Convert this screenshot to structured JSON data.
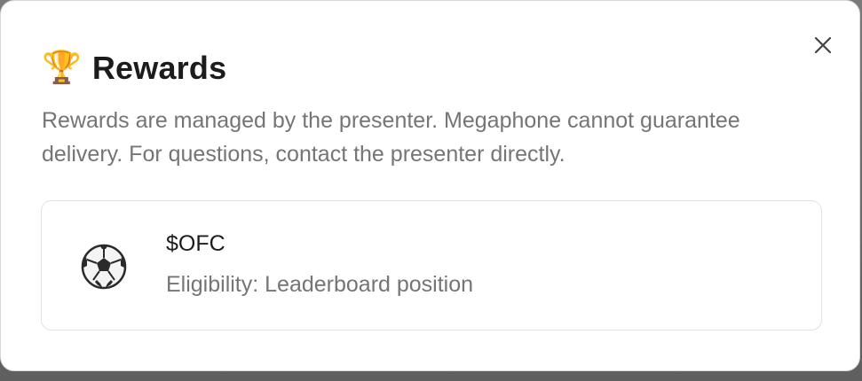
{
  "modal": {
    "title_emoji": "🏆",
    "title": "Rewards",
    "description": "Rewards are managed by the presenter. Megaphone cannot guarantee delivery. For questions, contact the presenter directly.",
    "close_icon": "close-icon"
  },
  "rewards": [
    {
      "icon": "soccer-ball-icon",
      "name": "$OFC",
      "eligibility": "Eligibility: Leaderboard position"
    }
  ],
  "colors": {
    "title": "#1c1c1c",
    "muted_text": "#757575",
    "card_border": "#e2e2e2",
    "backdrop": "#6b6b6b"
  }
}
